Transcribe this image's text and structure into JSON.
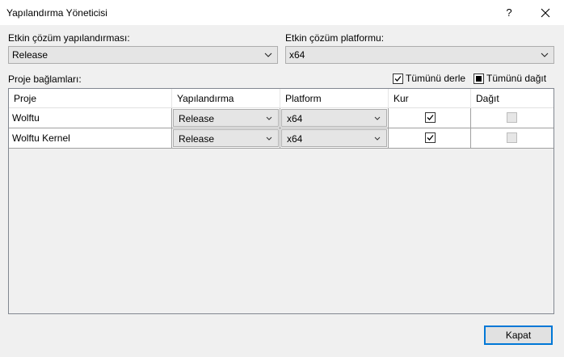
{
  "window": {
    "title": "Yapılandırma Yöneticisi",
    "help_glyph": "?"
  },
  "solution": {
    "config_label": "Etkin çözüm yapılandırması:",
    "config_value": "Release",
    "platform_label": "Etkin çözüm platformu:",
    "platform_value": "x64"
  },
  "contexts": {
    "label": "Proje bağlamları:",
    "build_all_label": "Tümünü derle",
    "deploy_all_label": "Tümünü dağıt"
  },
  "grid": {
    "columns": [
      "Proje",
      "Yapılandırma",
      "Platform",
      "Kur",
      "Dağıt"
    ],
    "rows": [
      {
        "project": "Wolftu",
        "configuration": "Release",
        "platform": "x64",
        "build": true,
        "deploy": false
      },
      {
        "project": "Wolftu Kernel",
        "configuration": "Release",
        "platform": "x64",
        "build": true,
        "deploy": false
      }
    ]
  },
  "footer": {
    "close_label": "Kapat"
  }
}
